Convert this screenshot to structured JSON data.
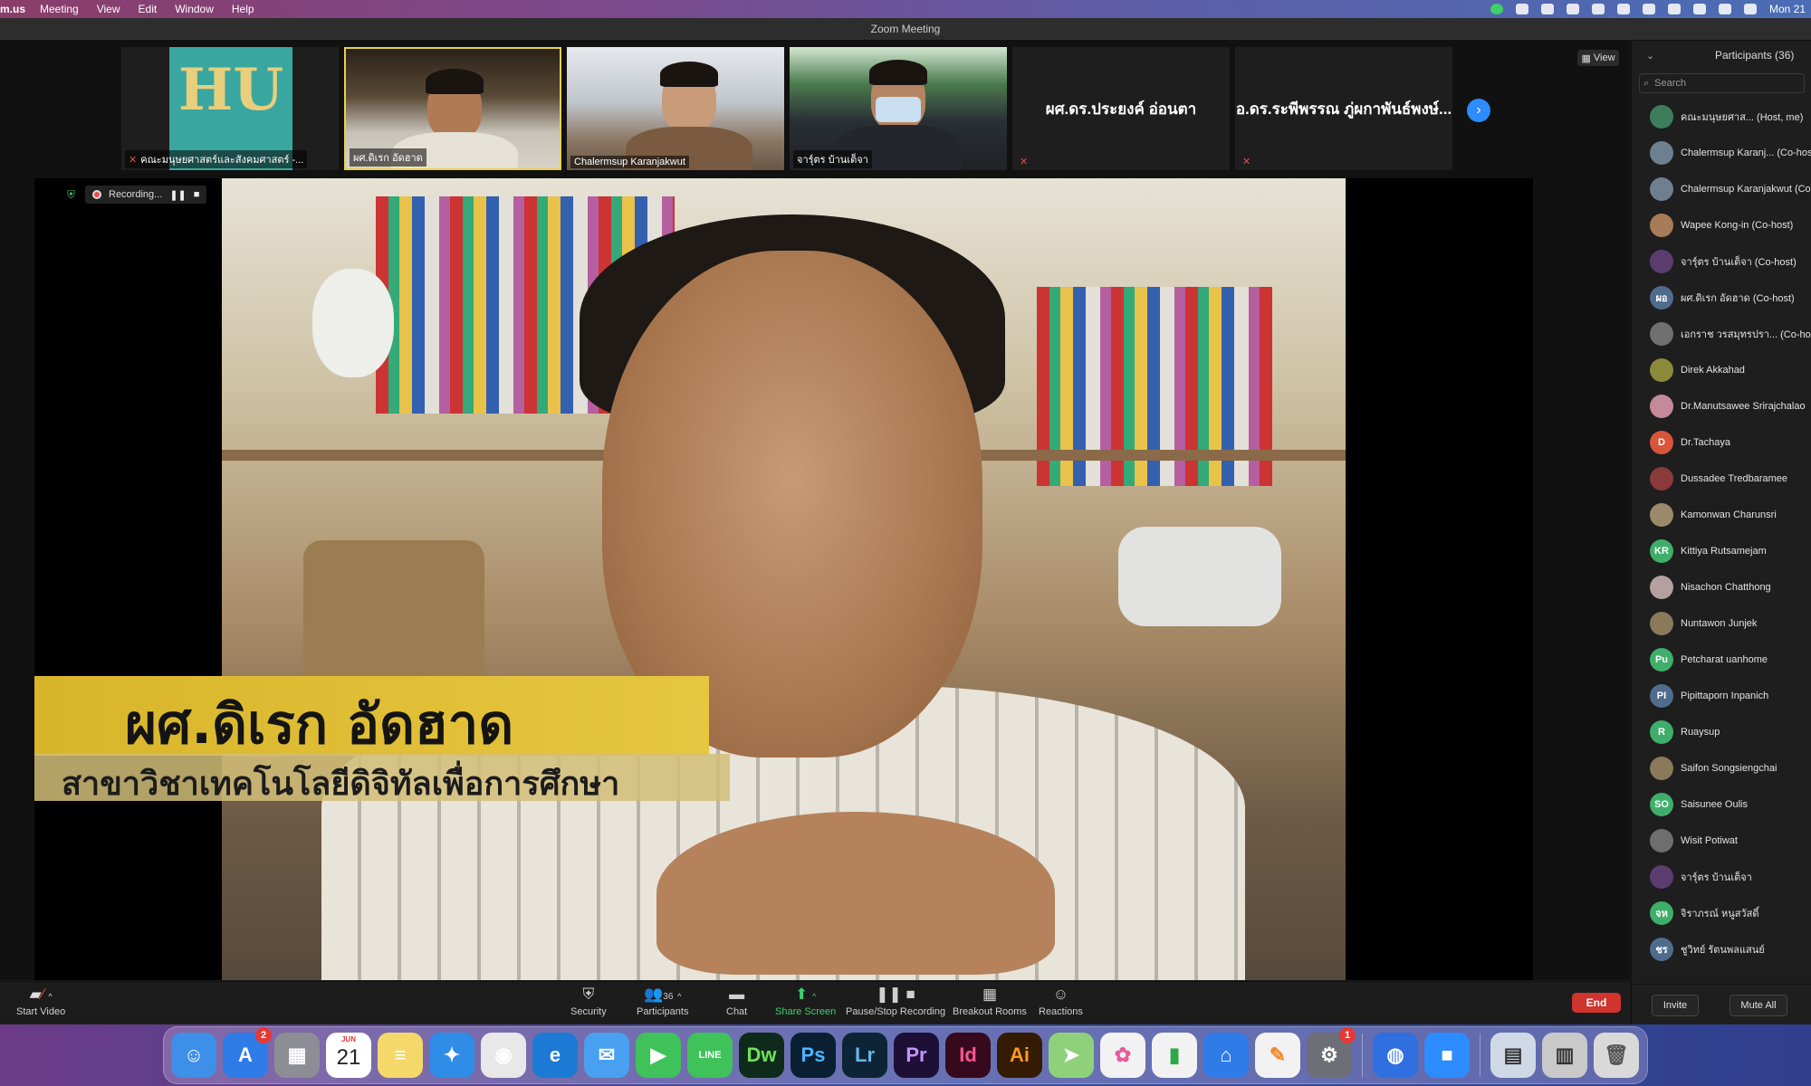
{
  "menubar": {
    "app": "m.us",
    "items": [
      "Meeting",
      "View",
      "Edit",
      "Window",
      "Help"
    ],
    "clock": "Mon 21"
  },
  "window": {
    "title": "Zoom Meeting"
  },
  "gallery": {
    "view_label": "View",
    "thumbnails": [
      {
        "name": "คณะมนุษยศาสตร์และสังคมศาสตร์ -...",
        "muted": true,
        "kind": "logo",
        "logo_text": "HU"
      },
      {
        "name": "ผศ.ดิเรก อัดฮาด",
        "muted": false,
        "kind": "video",
        "active": true
      },
      {
        "name": "Chalermsup Karanjakwut",
        "muted": false,
        "kind": "video"
      },
      {
        "name": "จารุ์ตร บ้านเต็จา",
        "muted": false,
        "kind": "video"
      },
      {
        "name": "",
        "muted": true,
        "kind": "name",
        "big_name": "ผศ.ดร.ประยงค์ อ่อนตา"
      },
      {
        "name": "",
        "muted": true,
        "kind": "name",
        "big_name": "อ.ดร.ระพีพรรณ ภู่ผกาพันธ์พงษ์..."
      }
    ]
  },
  "speaker": {
    "recording_label": "Recording...",
    "lower_third_name": "ผศ.ดิเรก อัดฮาด",
    "lower_third_title": "สาขาวิชาเทคโนโลยีดิจิทัลเพื่อการศึกษา"
  },
  "toolbar": {
    "start_video": "Start Video",
    "security": "Security",
    "participants": "Participants",
    "participants_count": "36",
    "chat": "Chat",
    "share_screen": "Share Screen",
    "recording": "Pause/Stop Recording",
    "breakout": "Breakout Rooms",
    "reactions": "Reactions",
    "end": "End",
    "colors": {
      "share": "#3fcf6a",
      "end": "#d0342c"
    }
  },
  "participants_panel": {
    "title": "Participants (36)",
    "search_placeholder": "Search",
    "invite": "Invite",
    "mute_all": "Mute All",
    "list": [
      {
        "name": "คณะมนุษยศาส...   (Host, me)",
        "initials": "",
        "color": "#3e7d5c"
      },
      {
        "name": "Chalermsup Karanj...  (Co-host)",
        "initials": "",
        "color": "#6e7f90"
      },
      {
        "name": "Chalermsup Karanjakwut (Co-host)",
        "initials": "",
        "color": "#6e7f90"
      },
      {
        "name": "Wapee Kong-in (Co-host)",
        "initials": "",
        "color": "#a77b58"
      },
      {
        "name": "จารุ์ตร บ้านเต็จา (Co-host)",
        "initials": "",
        "color": "#5a3d6e"
      },
      {
        "name": "ผศ.ดิเรก อัดฮาด (Co-host)",
        "initials": "ผอ",
        "color": "#4f6c8c"
      },
      {
        "name": "เอกราช วรสมุทรปรา...  (Co-host)",
        "initials": "",
        "color": "#707070"
      },
      {
        "name": "Direk Akkahad",
        "initials": "",
        "color": "#8a8a3a"
      },
      {
        "name": "Dr.Manutsawee Srirajchalao",
        "initials": "",
        "color": "#c4899a"
      },
      {
        "name": "Dr.Tachaya",
        "initials": "D",
        "color": "#d8543a"
      },
      {
        "name": "Dussadee Tredbaramee",
        "initials": "",
        "color": "#8a3a3a"
      },
      {
        "name": "Kamonwan Charunsri",
        "initials": "",
        "color": "#9b8a6a"
      },
      {
        "name": "Kittiya Rutsamejam",
        "initials": "KR",
        "color": "#3fae6a"
      },
      {
        "name": "Nisachon Chatthong",
        "initials": "",
        "color": "#b4a0a0"
      },
      {
        "name": "Nuntawon Junjek",
        "initials": "",
        "color": "#8a7a5a"
      },
      {
        "name": "Petcharat uanhome",
        "initials": "Pu",
        "color": "#3fae6a"
      },
      {
        "name": "Pipittaporn Inpanich",
        "initials": "PI",
        "color": "#4f6c8c"
      },
      {
        "name": "Ruaysup",
        "initials": "R",
        "color": "#3fae6a"
      },
      {
        "name": "Saifon Songsiengchai",
        "initials": "",
        "color": "#8a7a5a"
      },
      {
        "name": "Saisunee Oulis",
        "initials": "SO",
        "color": "#3fae6a"
      },
      {
        "name": "Wisit Potiwat",
        "initials": "",
        "color": "#6e6e6e"
      },
      {
        "name": "จารุ์ตร บ้านเต็จา",
        "initials": "",
        "color": "#5a3d6e"
      },
      {
        "name": "จิราภรณ์ หนูสวัสดิ์",
        "initials": "จห",
        "color": "#3fae6a"
      },
      {
        "name": "ชูวิทย์ รัตนพลแสนย์",
        "initials": "ชร",
        "color": "#4f6c8c"
      }
    ]
  },
  "dock": {
    "apps": [
      {
        "name": "Finder",
        "glyph": "☺",
        "color": "#3d8fe8"
      },
      {
        "name": "App Store",
        "glyph": "A",
        "color": "#2f7be8",
        "badge": "2"
      },
      {
        "name": "Launchpad",
        "glyph": "▦",
        "color": "#8d8d96"
      },
      {
        "name": "Calendar",
        "glyph": "",
        "color": "#ffffff",
        "cal_month": "JUN",
        "cal_day": "21"
      },
      {
        "name": "Notes",
        "glyph": "≡",
        "color": "#f4d86a"
      },
      {
        "name": "Safari",
        "glyph": "✦",
        "color": "#2f8de8"
      },
      {
        "name": "Chrome",
        "glyph": "◉",
        "color": "#e8e8e8"
      },
      {
        "name": "Edge",
        "glyph": "e",
        "color": "#1c7ad4"
      },
      {
        "name": "Mail",
        "glyph": "✉",
        "color": "#4aa0f0"
      },
      {
        "name": "FaceTime",
        "glyph": "▶",
        "color": "#3fc25a"
      },
      {
        "name": "LINE",
        "glyph": "LINE",
        "color": "#3fc25a"
      },
      {
        "name": "Dreamweaver",
        "glyph": "Dw",
        "color": "#0e2a1a",
        "fg": "#6fe05a"
      },
      {
        "name": "Photoshop",
        "glyph": "Ps",
        "color": "#0b1f33",
        "fg": "#4fb4ff"
      },
      {
        "name": "Lightroom",
        "glyph": "Lr",
        "color": "#0d2436",
        "fg": "#6ab7e8"
      },
      {
        "name": "Premiere",
        "glyph": "Pr",
        "color": "#1e0f36",
        "fg": "#c594ff"
      },
      {
        "name": "InDesign",
        "glyph": "Id",
        "color": "#36091c",
        "fg": "#ff5593"
      },
      {
        "name": "Illustrator",
        "glyph": "Ai",
        "color": "#331b04",
        "fg": "#ff9a1a"
      },
      {
        "name": "Maps",
        "glyph": "➤",
        "color": "#8fd17a"
      },
      {
        "name": "Photos",
        "glyph": "✿",
        "color": "#f2f2f2",
        "fg": "#e85a9a"
      },
      {
        "name": "Numbers",
        "glyph": "▮",
        "color": "#f2f2f2",
        "fg": "#2fa84a"
      },
      {
        "name": "Keynote",
        "glyph": "⌂",
        "color": "#2f7be8"
      },
      {
        "name": "Pages",
        "glyph": "✎",
        "color": "#f2f2f2",
        "fg": "#f28a2a"
      },
      {
        "name": "System Preferences",
        "glyph": "⚙",
        "color": "#6e6e76",
        "badge": "1"
      },
      {
        "name": "Network Drive",
        "glyph": "◍",
        "color": "#2f6fe0"
      },
      {
        "name": "Zoom",
        "glyph": "■",
        "color": "#2d8cff"
      },
      {
        "name": "Preview",
        "glyph": "▤",
        "color": "#cfd8e6",
        "fg": "#333"
      },
      {
        "name": "Downloads",
        "glyph": "▥",
        "color": "#c9c9c9",
        "fg": "#333"
      },
      {
        "name": "Trash",
        "glyph": "🗑",
        "color": "#d9d9d9",
        "fg": "#555"
      }
    ]
  }
}
